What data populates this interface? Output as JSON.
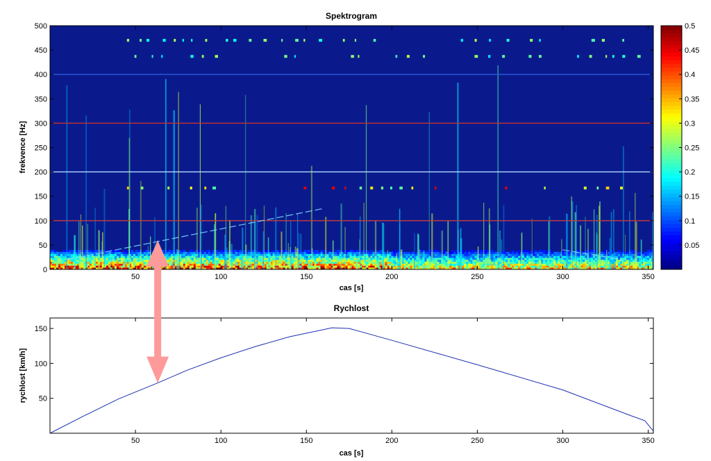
{
  "chart_data": [
    {
      "type": "heatmap",
      "title": "Spektrogram",
      "xlabel": "cas [s]",
      "ylabel": "frekvence [Hz]",
      "xlim": [
        0,
        353
      ],
      "ylim": [
        0,
        500
      ],
      "xticks": [
        50,
        100,
        150,
        200,
        250,
        300,
        350
      ],
      "yticks": [
        0,
        50,
        100,
        150,
        200,
        250,
        300,
        350,
        400,
        450,
        500
      ],
      "colorbar": {
        "range": [
          0,
          0.5
        ],
        "ticks": [
          0.05,
          0.1,
          0.15,
          0.2,
          0.25,
          0.3,
          0.35,
          0.4,
          0.45,
          0.5
        ],
        "colormap": "jet"
      },
      "background_color": "#0a1a8c",
      "horizontal_lines": [
        {
          "freq": 100,
          "color": "#c83c3c"
        },
        {
          "freq": 200,
          "color": "#b4dcff"
        },
        {
          "freq": 300,
          "color": "#c83232"
        },
        {
          "freq": 400,
          "color": "#2a5adc"
        }
      ],
      "band_freqs": [
        167,
        437,
        470
      ],
      "diagonal_tracks": [
        {
          "t0": 10,
          "f0": 20,
          "t1": 160,
          "f1": 125
        },
        {
          "t0": 300,
          "f0": 40,
          "t1": 335,
          "f1": 20
        }
      ],
      "grid": false
    },
    {
      "type": "line",
      "title": "Rychlost",
      "xlabel": "cas [s]",
      "ylabel": "rychlost [km/h]",
      "xlim": [
        0,
        353
      ],
      "ylim": [
        0,
        165
      ],
      "xticks": [
        50,
        100,
        150,
        200,
        250,
        300,
        350
      ],
      "yticks": [
        50,
        100,
        150
      ],
      "line_color": "#1c2fb0",
      "x": [
        0,
        20,
        40,
        63,
        80,
        100,
        120,
        140,
        165,
        175,
        200,
        250,
        300,
        340,
        348,
        353
      ],
      "y": [
        0,
        25,
        49,
        72,
        90,
        108,
        124,
        138,
        151,
        150,
        133,
        98,
        62,
        25,
        18,
        3
      ],
      "grid": false
    }
  ],
  "annotation": {
    "type": "double-arrow",
    "color": "#ff9a9a",
    "t": 63
  }
}
